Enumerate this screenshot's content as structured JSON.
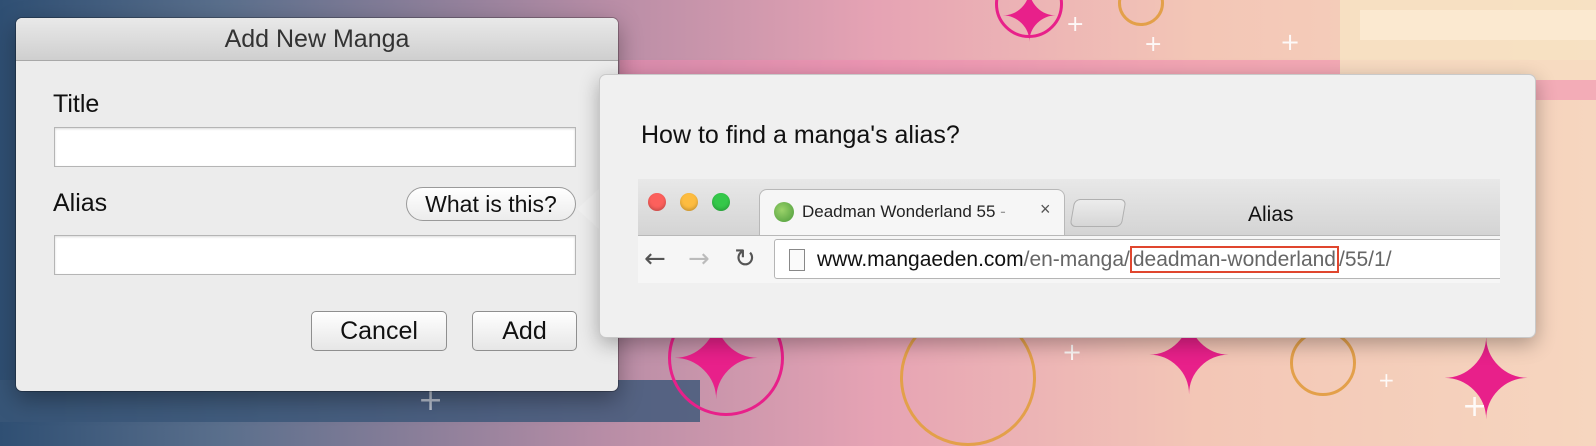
{
  "dialog": {
    "title": "Add New Manga",
    "title_label": "Title",
    "title_value": "",
    "alias_label": "Alias",
    "alias_value": "",
    "help_button": "What is this?",
    "cancel_button": "Cancel",
    "add_button": "Add"
  },
  "popover": {
    "heading": "How to find a manga's alias?",
    "alias_annotation": "Alias",
    "browser": {
      "tab_title": "Deadman Wonderland 55",
      "tab_title_fade": " -",
      "tab_close": "×",
      "url_domain": "www.mangaeden.com",
      "url_path1": "/en-manga/",
      "url_slug": "deadman-wonderland",
      "url_path2": "/55/1/"
    }
  },
  "icons": {
    "back": "back-arrow-icon",
    "forward": "forward-arrow-icon",
    "reload": "reload-icon",
    "page": "page-icon",
    "favicon": "favicon-icon"
  },
  "colors": {
    "highlight": "#e0462e",
    "close": "#fc605c",
    "minimize": "#fdbc40",
    "zoom": "#34c84a"
  }
}
